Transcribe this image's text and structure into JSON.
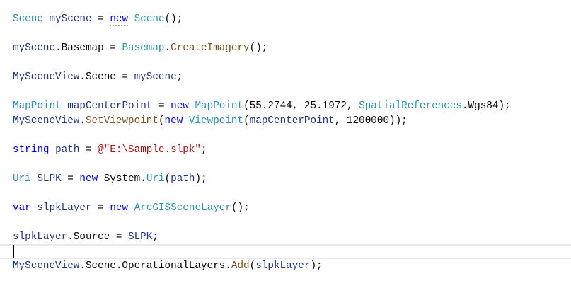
{
  "colors": {
    "type": "#2b91af",
    "local": "#1f377f",
    "keyword": "#0000ff",
    "method": "#74531f",
    "string": "#a31515",
    "plain": "#000000"
  },
  "current_line": 16,
  "lines": [
    [
      [
        "type",
        "Scene"
      ],
      [
        "plain",
        " "
      ],
      [
        "local",
        "myScene"
      ],
      [
        "plain",
        " = "
      ],
      [
        "kw",
        "new"
      ],
      [
        "plain",
        " "
      ],
      [
        "type",
        "Scene"
      ],
      [
        "plain",
        "();"
      ]
    ],
    [],
    [
      [
        "local",
        "myScene"
      ],
      [
        "plain",
        ".Basemap = "
      ],
      [
        "type",
        "Basemap"
      ],
      [
        "plain",
        "."
      ],
      [
        "method",
        "CreateImagery"
      ],
      [
        "plain",
        "();"
      ]
    ],
    [],
    [
      [
        "local",
        "MySceneView"
      ],
      [
        "plain",
        ".Scene = "
      ],
      [
        "local",
        "myScene"
      ],
      [
        "plain",
        ";"
      ]
    ],
    [],
    [
      [
        "type",
        "MapPoint"
      ],
      [
        "plain",
        " "
      ],
      [
        "local",
        "mapCenterPoint"
      ],
      [
        "plain",
        " = "
      ],
      [
        "kw",
        "new"
      ],
      [
        "plain",
        " "
      ],
      [
        "type",
        "MapPoint"
      ],
      [
        "plain",
        "(55.2744, 25.1972, "
      ],
      [
        "type",
        "SpatialReferences"
      ],
      [
        "plain",
        ".Wgs84);"
      ]
    ],
    [
      [
        "local",
        "MySceneView"
      ],
      [
        "plain",
        "."
      ],
      [
        "method",
        "SetViewpoint"
      ],
      [
        "plain",
        "("
      ],
      [
        "kw",
        "new"
      ],
      [
        "plain",
        " "
      ],
      [
        "type",
        "Viewpoint"
      ],
      [
        "plain",
        "("
      ],
      [
        "local",
        "mapCenterPoint"
      ],
      [
        "plain",
        ", 1200000));"
      ]
    ],
    [],
    [
      [
        "kw",
        "string"
      ],
      [
        "plain",
        " "
      ],
      [
        "local",
        "path"
      ],
      [
        "plain",
        " = "
      ],
      [
        "str",
        "@\"E:\\Sample.slpk\""
      ],
      [
        "plain",
        ";"
      ]
    ],
    [],
    [
      [
        "type",
        "Uri"
      ],
      [
        "plain",
        " "
      ],
      [
        "local",
        "SLPK"
      ],
      [
        "plain",
        " = "
      ],
      [
        "kw",
        "new"
      ],
      [
        "plain",
        " System."
      ],
      [
        "type",
        "Uri"
      ],
      [
        "plain",
        "("
      ],
      [
        "local",
        "path"
      ],
      [
        "plain",
        ");"
      ]
    ],
    [],
    [
      [
        "kw",
        "var"
      ],
      [
        "plain",
        " "
      ],
      [
        "local",
        "slpkLayer"
      ],
      [
        "plain",
        " = "
      ],
      [
        "kw",
        "new"
      ],
      [
        "plain",
        " "
      ],
      [
        "type",
        "ArcGISSceneLayer"
      ],
      [
        "plain",
        "();"
      ]
    ],
    [],
    [
      [
        "local",
        "slpkLayer"
      ],
      [
        "plain",
        ".Source = "
      ],
      [
        "local",
        "SLPK"
      ],
      [
        "plain",
        ";"
      ]
    ],
    [],
    [
      [
        "local",
        "MySceneView"
      ],
      [
        "plain",
        ".Scene.OperationalLayers."
      ],
      [
        "method",
        "Add"
      ],
      [
        "plain",
        "("
      ],
      [
        "local",
        "slpkLayer"
      ],
      [
        "plain",
        ");"
      ]
    ]
  ]
}
